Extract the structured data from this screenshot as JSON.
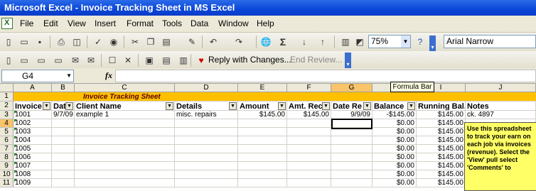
{
  "window": {
    "title": "Microsoft Excel - Invoice Tracking Sheet in MS Excel"
  },
  "menu": [
    "File",
    "Edit",
    "View",
    "Insert",
    "Format",
    "Tools",
    "Data",
    "Window",
    "Help"
  ],
  "toolbar": {
    "zoom": "75%",
    "font": "Arial Narrow",
    "sigma": "Σ"
  },
  "reviewing": {
    "reply": "Reply with Changes...",
    "end_review": "End Review..."
  },
  "formula": {
    "cell_ref": "G4",
    "fx": "fx",
    "value": ""
  },
  "tooltip": "Formula Bar",
  "columns": [
    "A",
    "B",
    "C",
    "D",
    "E",
    "F",
    "G",
    "H",
    "I",
    "J"
  ],
  "sheet_title": "Invoice Tracking Sheet",
  "headers": [
    "Invoice",
    "Dat",
    "Client Name",
    "Details",
    "Amount",
    "Amt. Rec",
    "Date Re",
    "Balance",
    "Running Bal.",
    "Notes"
  ],
  "rows": [
    {
      "num": "1"
    },
    {
      "num": "2"
    },
    {
      "num": "3",
      "cells": [
        "1001",
        "9/7/09",
        "example 1",
        "misc. repairs",
        "$145.00",
        "$145.00",
        "9/9/09",
        "-$145.00",
        "$145.00",
        "ck. 4897"
      ]
    },
    {
      "num": "4",
      "cells": [
        "1002",
        "",
        "",
        "",
        "",
        "",
        "",
        "$0.00",
        "$145.00",
        ""
      ]
    },
    {
      "num": "5",
      "cells": [
        "1003",
        "",
        "",
        "",
        "",
        "",
        "",
        "$0.00",
        "$145.00",
        ""
      ]
    },
    {
      "num": "6",
      "cells": [
        "1004",
        "",
        "",
        "",
        "",
        "",
        "",
        "$0.00",
        "$145.00",
        ""
      ]
    },
    {
      "num": "7",
      "cells": [
        "1005",
        "",
        "",
        "",
        "",
        "",
        "",
        "$0.00",
        "$145.00",
        ""
      ]
    },
    {
      "num": "8",
      "cells": [
        "1006",
        "",
        "",
        "",
        "",
        "",
        "",
        "$0.00",
        "$145.00",
        ""
      ]
    },
    {
      "num": "9",
      "cells": [
        "1007",
        "",
        "",
        "",
        "",
        "",
        "",
        "$0.00",
        "$145.00",
        ""
      ]
    },
    {
      "num": "10",
      "cells": [
        "1008",
        "",
        "",
        "",
        "",
        "",
        "",
        "$0.00",
        "$145.00",
        ""
      ]
    },
    {
      "num": "11",
      "cells": [
        "1009",
        "",
        "",
        "",
        "",
        "",
        "",
        "$0.00",
        "$145.00",
        ""
      ]
    }
  ],
  "comment": "Use this spreadsheet to track your earn on each job via invoices (revenue). Select the 'View' pull select 'Comments' to",
  "colors": {
    "title_bar": "#0a46d8",
    "sheet_title_fill": "#ffc000",
    "comment_fill": "#ffff66",
    "selected_header": "#f9c46a"
  }
}
